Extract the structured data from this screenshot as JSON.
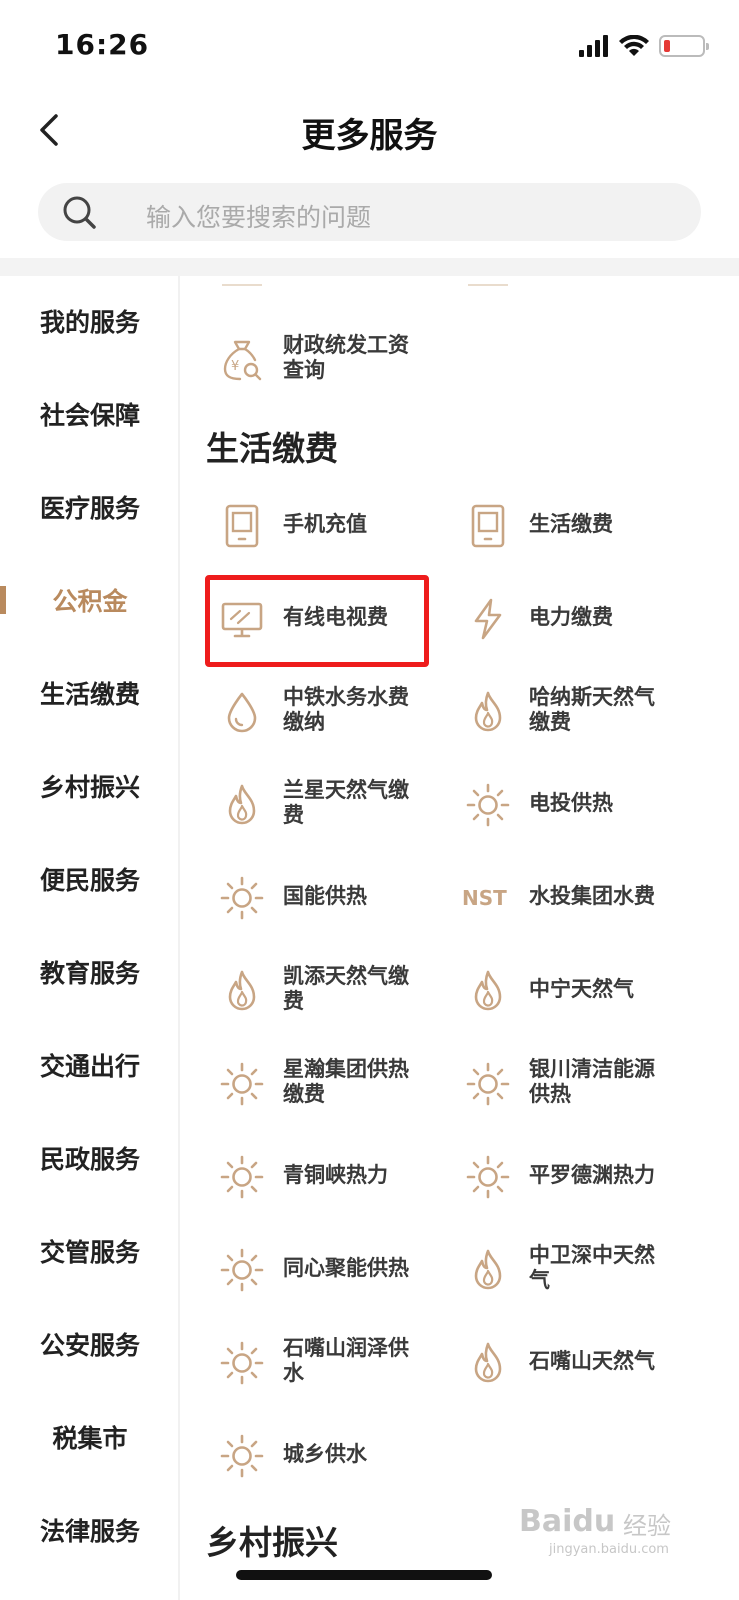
{
  "status_bar": {
    "time": "16:26"
  },
  "nav": {
    "title": "更多服务"
  },
  "search": {
    "placeholder": "输入您要搜索的问题"
  },
  "sidebar": {
    "items": [
      {
        "label": "我的服务",
        "active": false
      },
      {
        "label": "社会保障",
        "active": false
      },
      {
        "label": "医疗服务",
        "active": false
      },
      {
        "label": "公积金",
        "active": true
      },
      {
        "label": "生活缴费",
        "active": false
      },
      {
        "label": "乡村振兴",
        "active": false
      },
      {
        "label": "便民服务",
        "active": false
      },
      {
        "label": "教育服务",
        "active": false
      },
      {
        "label": "交通出行",
        "active": false
      },
      {
        "label": "民政服务",
        "active": false
      },
      {
        "label": "交管服务",
        "active": false
      },
      {
        "label": "公安服务",
        "active": false
      },
      {
        "label": "税集市",
        "active": false
      },
      {
        "label": "法律服务",
        "active": false
      }
    ]
  },
  "content": {
    "prev_section_items": [
      {
        "label": "财政统发工资查询",
        "icon": "money-bag-search-icon"
      }
    ],
    "section_title": "生活缴费",
    "services": [
      {
        "label": "手机充值",
        "icon": "phone-icon"
      },
      {
        "label": "生活缴费",
        "icon": "phone-icon"
      },
      {
        "label": "有线电视费",
        "icon": "tv-icon"
      },
      {
        "label": "电力缴费",
        "icon": "lightning-icon"
      },
      {
        "label": "中铁水务水费缴纳",
        "icon": "water-drop-icon"
      },
      {
        "label": "哈纳斯天然气缴费",
        "icon": "flame-icon"
      },
      {
        "label": "兰星天然气缴费",
        "icon": "flame-icon"
      },
      {
        "label": "电投供热",
        "icon": "sun-icon"
      },
      {
        "label": "国能供热",
        "icon": "sun-icon"
      },
      {
        "label": "水投集团水费",
        "icon": "nst-logo-icon"
      },
      {
        "label": "凯添天然气缴费",
        "icon": "flame-icon"
      },
      {
        "label": "中宁天然气",
        "icon": "flame-icon"
      },
      {
        "label": "星瀚集团供热缴费",
        "icon": "sun-icon"
      },
      {
        "label": "银川清洁能源供热",
        "icon": "sun-icon"
      },
      {
        "label": "青铜峡热力",
        "icon": "sun-icon"
      },
      {
        "label": "平罗德渊热力",
        "icon": "sun-icon"
      },
      {
        "label": "同心聚能供热",
        "icon": "sun-icon"
      },
      {
        "label": "中卫深中天然气",
        "icon": "flame-icon"
      },
      {
        "label": "石嘴山润泽供水",
        "icon": "sun-icon"
      },
      {
        "label": "石嘴山天然气",
        "icon": "flame-icon"
      },
      {
        "label": "城乡供水",
        "icon": "sun-icon"
      }
    ],
    "next_section_title": "乡村振兴",
    "nst_logo_text": "NST"
  },
  "watermark": {
    "brand": "Baidu",
    "suffix": "经验",
    "site": "jingyan.baidu.com"
  },
  "colors": {
    "accent": "#b98a5e",
    "icon": "#c8a584",
    "highlight": "#ee1c1c"
  }
}
